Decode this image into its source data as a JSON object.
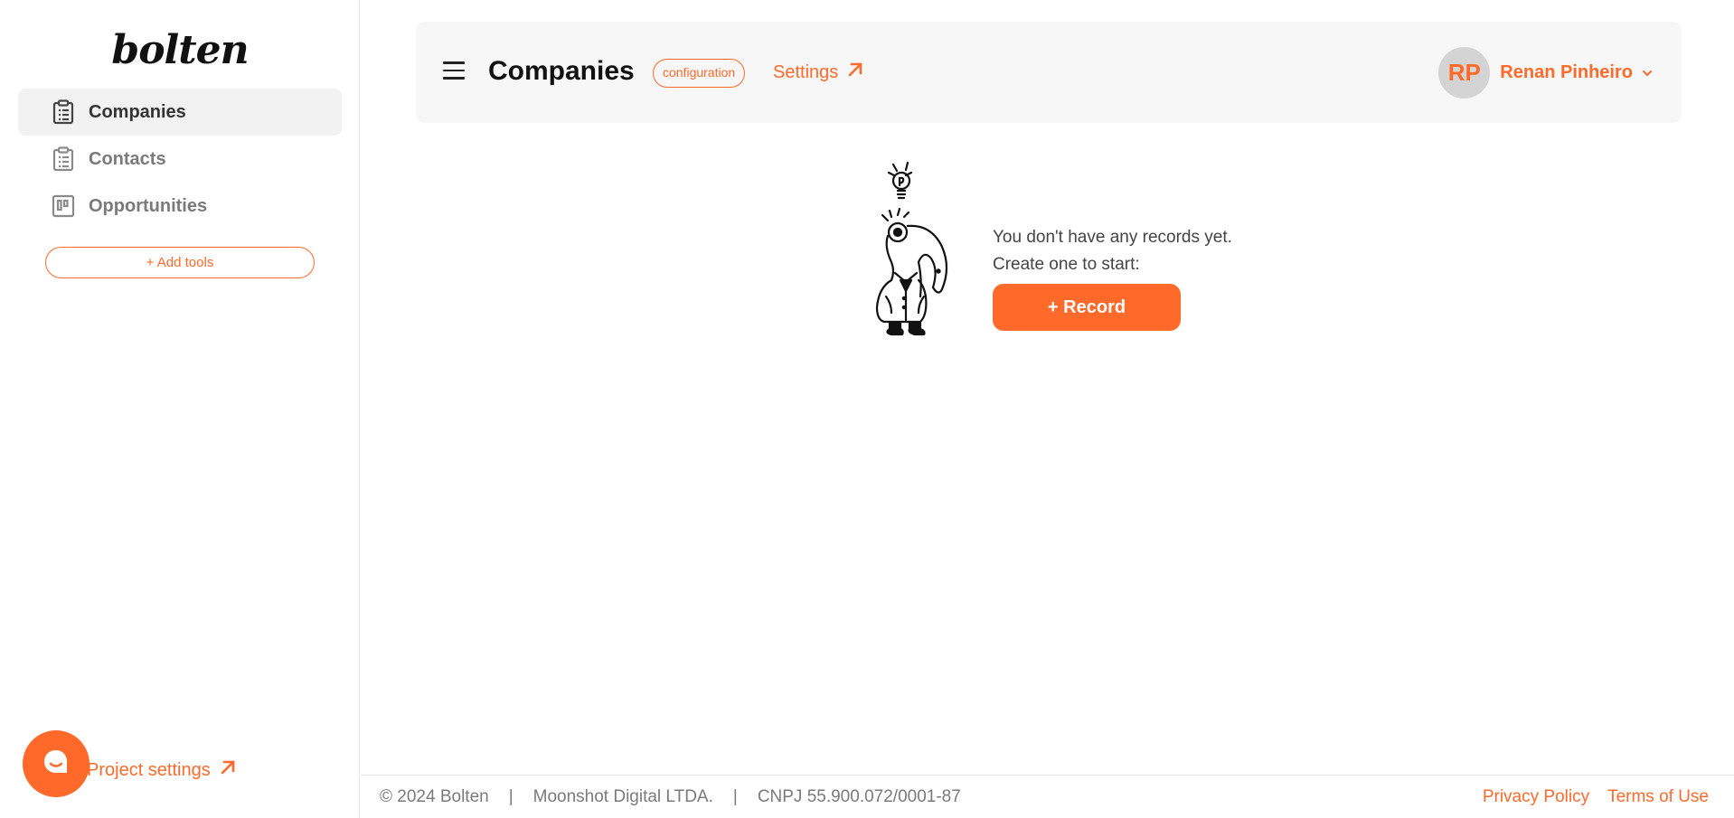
{
  "sidebar": {
    "logo": "bolten",
    "items": [
      {
        "label": "Companies",
        "icon": "clipboard-list-icon",
        "active": true
      },
      {
        "label": "Contacts",
        "icon": "clipboard-list-icon",
        "active": false
      },
      {
        "label": "Opportunities",
        "icon": "kanban-board-icon",
        "active": false
      }
    ],
    "add_tools_label": "+ Add tools",
    "project_settings_label": "Project settings"
  },
  "header": {
    "title": "Companies",
    "badge": "configuration",
    "settings_label": "Settings",
    "user": {
      "initials": "RP",
      "name": "Renan Pinheiro"
    }
  },
  "empty_state": {
    "line1": "You don't have any records yet.",
    "line2": "Create one to start:",
    "button_label": "+ Record"
  },
  "footer": {
    "copyright": "© 2024 Bolten",
    "company": "Moonshot Digital LTDA.",
    "cnpj": "CNPJ 55.900.072/0001-87",
    "separator": "|",
    "privacy": "Privacy Policy",
    "terms": "Terms of Use"
  },
  "colors": {
    "accent": "#ff6a2b",
    "sidebar_active_bg": "#f2f2f2",
    "header_bg": "#f7f7f7"
  }
}
